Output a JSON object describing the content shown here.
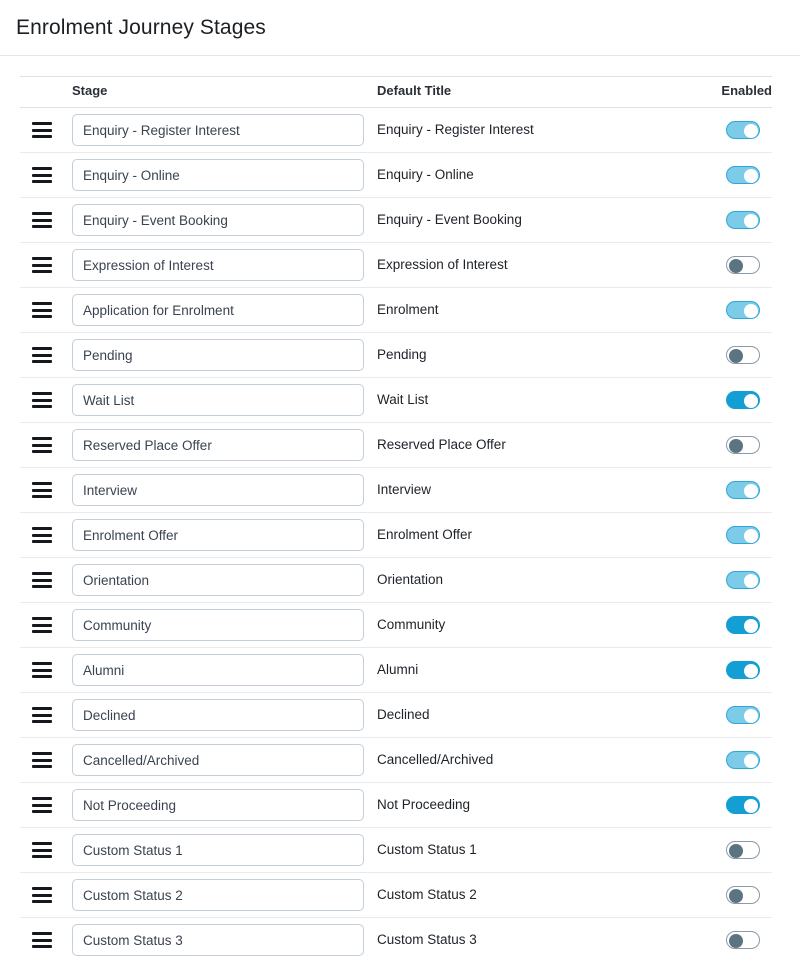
{
  "header": {
    "title": "Enrolment Journey Stages"
  },
  "table": {
    "columns": {
      "handle": "",
      "stage": "Stage",
      "default_title": "Default Title",
      "enabled": "Enabled"
    },
    "drag_handle_icon": "drag-handle-icon",
    "rows": [
      {
        "stage": "Enquiry - Register Interest",
        "default_title": "Enquiry - Register Interest",
        "enabled": true,
        "toggle_style": "on-muted"
      },
      {
        "stage": "Enquiry - Online",
        "default_title": "Enquiry - Online",
        "enabled": true,
        "toggle_style": "on-muted"
      },
      {
        "stage": "Enquiry - Event Booking",
        "default_title": "Enquiry - Event Booking",
        "enabled": true,
        "toggle_style": "on-muted"
      },
      {
        "stage": "Expression of Interest",
        "default_title": "Expression of Interest",
        "enabled": false,
        "toggle_style": "off"
      },
      {
        "stage": "Application for Enrolment",
        "default_title": "Enrolment",
        "enabled": true,
        "toggle_style": "on-muted"
      },
      {
        "stage": "Pending",
        "default_title": "Pending",
        "enabled": false,
        "toggle_style": "off"
      },
      {
        "stage": "Wait List",
        "default_title": "Wait List",
        "enabled": true,
        "toggle_style": "on-strong"
      },
      {
        "stage": "Reserved Place Offer",
        "default_title": "Reserved Place Offer",
        "enabled": false,
        "toggle_style": "off"
      },
      {
        "stage": "Interview",
        "default_title": "Interview",
        "enabled": true,
        "toggle_style": "on-muted"
      },
      {
        "stage": "Enrolment Offer",
        "default_title": "Enrolment Offer",
        "enabled": true,
        "toggle_style": "on-muted"
      },
      {
        "stage": "Orientation",
        "default_title": "Orientation",
        "enabled": true,
        "toggle_style": "on-muted"
      },
      {
        "stage": "Community",
        "default_title": "Community",
        "enabled": true,
        "toggle_style": "on-strong"
      },
      {
        "stage": "Alumni",
        "default_title": "Alumni",
        "enabled": true,
        "toggle_style": "on-strong"
      },
      {
        "stage": "Declined",
        "default_title": "Declined",
        "enabled": true,
        "toggle_style": "on-muted"
      },
      {
        "stage": "Cancelled/Archived",
        "default_title": "Cancelled/Archived",
        "enabled": true,
        "toggle_style": "on-muted"
      },
      {
        "stage": "Not Proceeding",
        "default_title": "Not Proceeding",
        "enabled": true,
        "toggle_style": "on-strong"
      },
      {
        "stage": "Custom Status 1",
        "default_title": "Custom Status 1",
        "enabled": false,
        "toggle_style": "off"
      },
      {
        "stage": "Custom Status 2",
        "default_title": "Custom Status 2",
        "enabled": false,
        "toggle_style": "off"
      },
      {
        "stage": "Custom Status 3",
        "default_title": "Custom Status 3",
        "enabled": false,
        "toggle_style": "off"
      }
    ]
  },
  "colors": {
    "toggle_on_strong": "#139fd4",
    "toggle_on_muted": "#7ccbe8",
    "toggle_off_knob": "#5c7382",
    "input_border": "#c2ced9",
    "row_divider": "#e8eaec",
    "text_primary": "#1d2228"
  }
}
